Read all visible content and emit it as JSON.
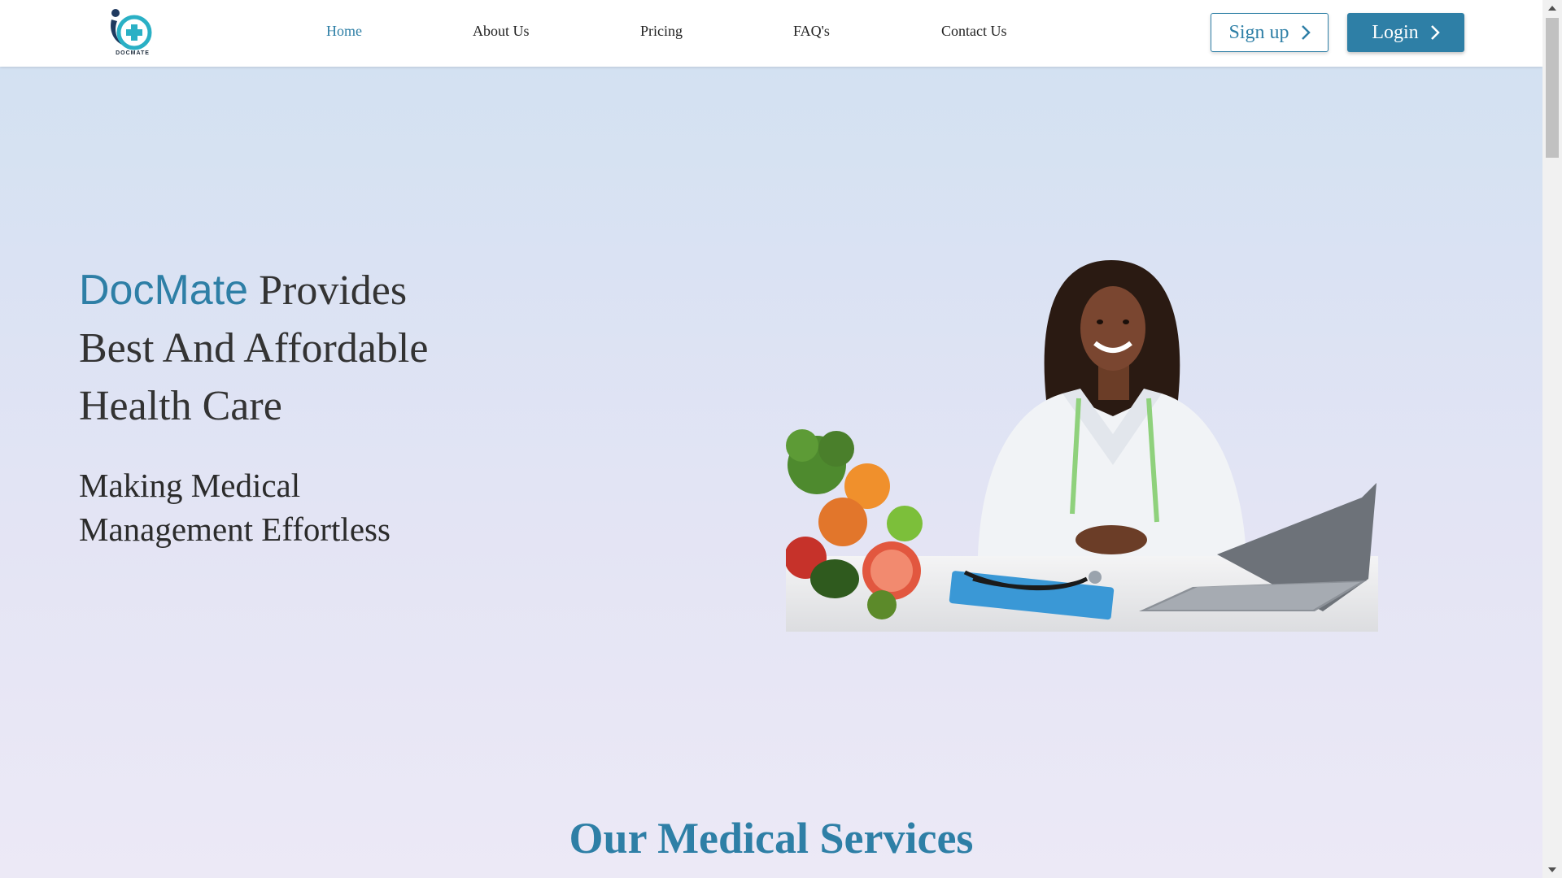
{
  "header": {
    "logo_text": "DOCMATE",
    "nav": [
      {
        "label": "Home",
        "active": true
      },
      {
        "label": "About Us",
        "active": false
      },
      {
        "label": "Pricing",
        "active": false
      },
      {
        "label": "FAQ's",
        "active": false
      },
      {
        "label": "Contact Us",
        "active": false
      }
    ],
    "signup_label": "Sign up",
    "login_label": "Login"
  },
  "hero": {
    "title_brand": "DocMate",
    "title_rest_line1": " Provides",
    "title_line2": "Best And Affordable",
    "title_line3": "Health Care",
    "subtitle_line1": "Making Medical",
    "subtitle_line2": "Management Effortless"
  },
  "services": {
    "title": "Our Medical Services"
  },
  "colors": {
    "accent": "#2e7fa6",
    "hero_gradient_top": "#d3e1f2",
    "hero_gradient_bottom": "#ece9f6"
  },
  "icons": [
    "docmate-logo",
    "chevron-right-icon",
    "scroll-up-icon",
    "scroll-down-icon"
  ]
}
